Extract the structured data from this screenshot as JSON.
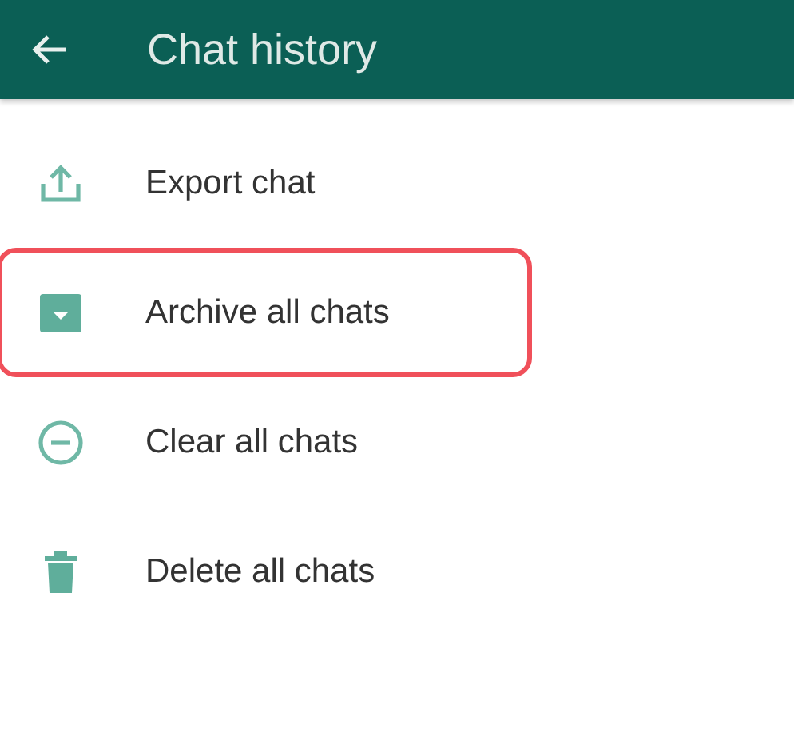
{
  "header": {
    "title": "Chat history"
  },
  "items": [
    {
      "kind": "export",
      "label": "Export chat",
      "highlighted": false
    },
    {
      "kind": "archive",
      "label": "Archive all chats",
      "highlighted": true
    },
    {
      "kind": "clear",
      "label": "Clear all chats",
      "highlighted": false
    },
    {
      "kind": "delete",
      "label": "Delete all chats",
      "highlighted": false
    }
  ]
}
